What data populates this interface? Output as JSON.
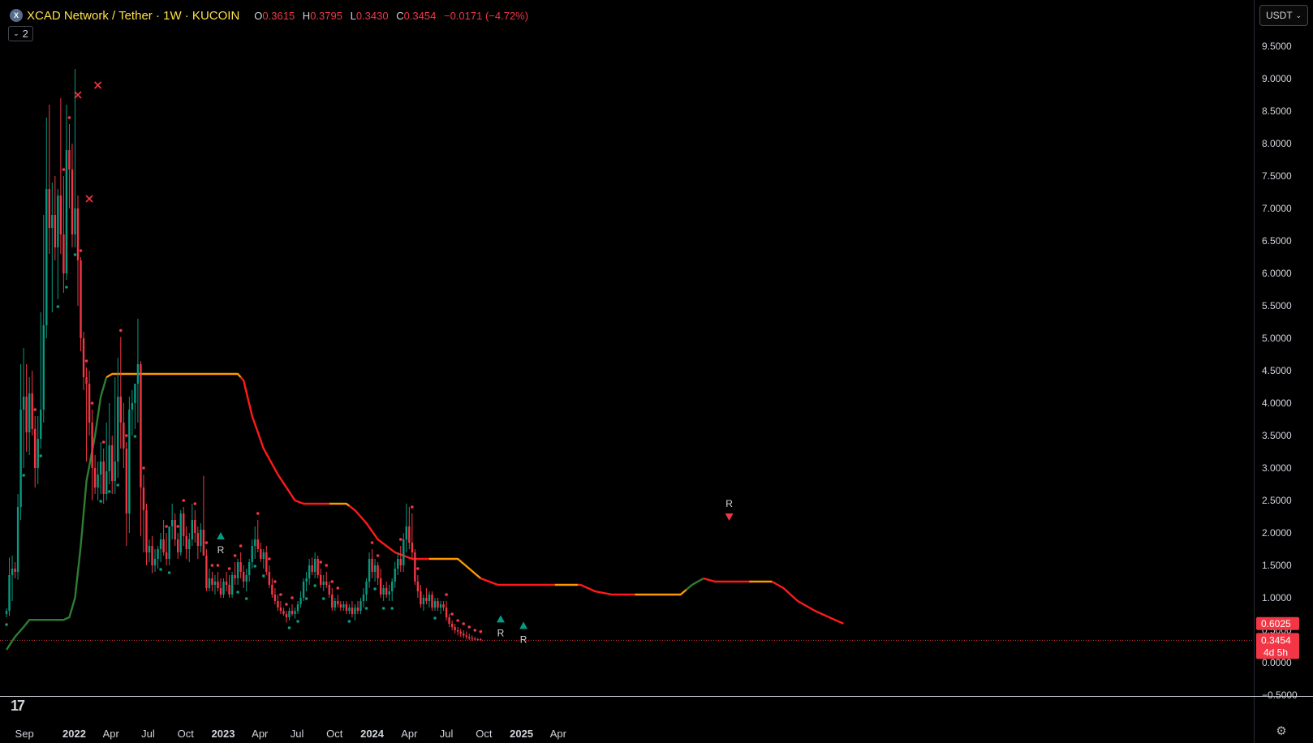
{
  "header": {
    "title": "XCAD Network / Tether · 1W · KUCOIN",
    "o_label": "O",
    "o_value": "0.3615",
    "h_label": "H",
    "h_value": "0.3795",
    "l_label": "L",
    "l_value": "0.3430",
    "c_label": "C",
    "c_value": "0.3454",
    "change": "−0.0171 (−4.72%)"
  },
  "legend_toggle": {
    "count": "2",
    "icon": "chevron-down-icon"
  },
  "currency_button": {
    "label": "USDT",
    "icon": "chevron-down-icon"
  },
  "price_labels": {
    "indicator": {
      "value": "0.6025",
      "color": "#f23645"
    },
    "last": {
      "value": "0.3454",
      "countdown": "4d 5h",
      "color": "#f23645"
    }
  },
  "colors": {
    "up": "#089981",
    "down": "#f23645",
    "trend_up": "#2e7d32",
    "trend_down": "#ff1a1a",
    "flat": "#ff9800",
    "text": "#d1d4dc",
    "background": "#000000"
  },
  "chart_data": {
    "type": "candlestick",
    "symbol": "XCAD Network / Tether",
    "interval": "1W",
    "exchange": "KUCOIN",
    "ylim": [
      -0.5,
      10
    ],
    "y_ticks": [
      "9.5000",
      "9.0000",
      "8.5000",
      "8.0000",
      "7.5000",
      "7.0000",
      "6.5000",
      "6.0000",
      "5.5000",
      "5.0000",
      "4.5000",
      "4.0000",
      "3.5000",
      "3.0000",
      "2.5000",
      "2.0000",
      "1.5000",
      "1.0000",
      "0.5000",
      "0.0000",
      "−0.5000"
    ],
    "x_ticks": [
      {
        "label": "Sep",
        "date": "2021-09-01",
        "bold": false
      },
      {
        "label": "2022",
        "date": "2022-01-01",
        "bold": true
      },
      {
        "label": "Apr",
        "date": "2022-04-01",
        "bold": false
      },
      {
        "label": "Jul",
        "date": "2022-07-01",
        "bold": false
      },
      {
        "label": "Oct",
        "date": "2022-10-01",
        "bold": false
      },
      {
        "label": "2023",
        "date": "2023-01-01",
        "bold": true
      },
      {
        "label": "Apr",
        "date": "2023-04-01",
        "bold": false
      },
      {
        "label": "Jul",
        "date": "2023-07-01",
        "bold": false
      },
      {
        "label": "Oct",
        "date": "2023-10-01",
        "bold": false
      },
      {
        "label": "2024",
        "date": "2024-01-01",
        "bold": true
      },
      {
        "label": "Apr",
        "date": "2024-04-01",
        "bold": false
      },
      {
        "label": "Jul",
        "date": "2024-07-01",
        "bold": false
      },
      {
        "label": "Oct",
        "date": "2024-10-01",
        "bold": false
      },
      {
        "label": "2025",
        "date": "2025-01-01",
        "bold": true
      },
      {
        "label": "Apr",
        "date": "2025-04-01",
        "bold": false
      }
    ],
    "first_bar_date": "2021-07-19",
    "candles": [
      [
        0.75,
        0.84,
        0.7,
        0.8
      ],
      [
        0.8,
        1.62,
        0.72,
        1.35
      ],
      [
        1.35,
        1.65,
        0.95,
        1.45
      ],
      [
        1.45,
        1.55,
        1.3,
        1.4
      ],
      [
        1.4,
        2.6,
        1.28,
        2.4
      ],
      [
        2.4,
        4.6,
        2.2,
        3.9
      ],
      [
        3.9,
        4.85,
        3.0,
        4.1
      ],
      [
        4.1,
        4.6,
        3.25,
        3.55
      ],
      [
        3.55,
        4.4,
        3.2,
        4.15
      ],
      [
        4.15,
        4.5,
        3.5,
        3.6
      ],
      [
        3.6,
        3.8,
        2.7,
        3.0
      ],
      [
        3.0,
        3.8,
        2.75,
        3.45
      ],
      [
        3.45,
        5.4,
        3.3,
        3.9
      ],
      [
        3.9,
        6.9,
        3.7,
        5.2
      ],
      [
        5.2,
        8.4,
        5.0,
        7.3
      ],
      [
        7.3,
        8.6,
        6.3,
        6.7
      ],
      [
        6.7,
        7.4,
        5.4,
        6.9
      ],
      [
        6.9,
        7.5,
        6.2,
        6.4
      ],
      [
        6.4,
        7.3,
        5.6,
        7.2
      ],
      [
        7.2,
        8.7,
        6.3,
        6.6
      ],
      [
        6.6,
        7.5,
        5.7,
        6.0
      ],
      [
        6.0,
        8.6,
        5.9,
        7.9
      ],
      [
        7.9,
        8.3,
        7.0,
        7.6
      ],
      [
        7.6,
        8.0,
        6.4,
        6.6
      ],
      [
        6.6,
        9.15,
        6.4,
        7.0
      ],
      [
        7.0,
        7.2,
        5.5,
        6.2
      ],
      [
        6.2,
        6.25,
        4.8,
        5.0
      ],
      [
        5.0,
        5.1,
        4.2,
        4.4
      ],
      [
        4.4,
        4.55,
        3.1,
        4.3
      ],
      [
        4.3,
        4.5,
        3.5,
        3.7
      ],
      [
        3.7,
        3.9,
        2.5,
        3.0
      ],
      [
        3.0,
        3.2,
        2.6,
        2.7
      ],
      [
        2.7,
        3.1,
        2.5,
        2.9
      ],
      [
        2.9,
        3.4,
        2.6,
        3.1
      ],
      [
        3.1,
        3.3,
        2.45,
        2.6
      ],
      [
        2.6,
        3.7,
        2.5,
        2.95
      ],
      [
        2.95,
        4.0,
        2.75,
        3.35
      ],
      [
        3.35,
        3.5,
        2.6,
        2.8
      ],
      [
        2.8,
        4.4,
        2.6,
        3.1
      ],
      [
        3.1,
        4.7,
        2.85,
        4.1
      ],
      [
        4.1,
        5.02,
        3.3,
        3.7
      ],
      [
        3.7,
        4.0,
        3.0,
        3.3
      ],
      [
        3.3,
        3.4,
        1.8,
        2.3
      ],
      [
        2.3,
        4.1,
        2.0,
        3.9
      ],
      [
        3.9,
        4.2,
        3.5,
        4.0
      ],
      [
        4.0,
        4.3,
        3.6,
        4.3
      ],
      [
        4.3,
        5.3,
        3.7,
        4.6
      ],
      [
        4.6,
        4.65,
        1.95,
        2.7
      ],
      [
        2.7,
        2.9,
        1.7,
        2.35
      ],
      [
        2.35,
        2.45,
        1.5,
        1.7
      ],
      [
        1.7,
        1.9,
        1.55,
        1.8
      ],
      [
        1.8,
        1.95,
        1.38,
        1.5
      ],
      [
        1.5,
        1.75,
        1.4,
        1.6
      ],
      [
        1.6,
        1.8,
        1.45,
        1.75
      ],
      [
        1.75,
        2.0,
        1.55,
        1.9
      ],
      [
        1.9,
        2.2,
        1.65,
        1.7
      ],
      [
        1.7,
        2.0,
        1.5,
        1.6
      ],
      [
        1.6,
        2.05,
        1.5,
        2.1
      ],
      [
        2.1,
        2.45,
        1.9,
        2.2
      ],
      [
        2.2,
        2.3,
        1.8,
        1.9
      ],
      [
        1.9,
        2.0,
        1.6,
        1.7
      ],
      [
        1.7,
        2.35,
        1.65,
        2.3
      ],
      [
        2.3,
        2.4,
        1.8,
        1.95
      ],
      [
        1.95,
        2.1,
        1.6,
        1.75
      ],
      [
        1.75,
        2.0,
        1.55,
        1.9
      ],
      [
        1.9,
        2.45,
        1.8,
        2.2
      ],
      [
        2.2,
        2.35,
        1.85,
        2.0
      ],
      [
        2.0,
        2.1,
        1.6,
        1.8
      ],
      [
        1.8,
        2.15,
        1.7,
        2.05
      ],
      [
        2.05,
        2.88,
        1.75,
        1.65
      ],
      [
        1.65,
        1.75,
        1.1,
        1.15
      ],
      [
        1.15,
        1.45,
        1.1,
        1.3
      ],
      [
        1.3,
        1.4,
        1.1,
        1.2
      ],
      [
        1.2,
        1.35,
        1.05,
        1.25
      ],
      [
        1.25,
        1.4,
        1.1,
        1.15
      ],
      [
        1.15,
        1.3,
        1.0,
        1.05
      ],
      [
        1.05,
        1.3,
        1.0,
        1.25
      ],
      [
        1.25,
        1.4,
        1.1,
        1.2
      ],
      [
        1.2,
        1.35,
        1.0,
        1.05
      ],
      [
        1.05,
        1.4,
        1.0,
        1.35
      ],
      [
        1.35,
        1.55,
        1.2,
        1.3
      ],
      [
        1.3,
        1.6,
        1.2,
        1.55
      ],
      [
        1.55,
        1.7,
        1.3,
        1.4
      ],
      [
        1.4,
        1.5,
        1.15,
        1.25
      ],
      [
        1.25,
        1.45,
        1.1,
        1.35
      ],
      [
        1.35,
        1.6,
        1.25,
        1.55
      ],
      [
        1.55,
        1.9,
        1.45,
        1.8
      ],
      [
        1.8,
        2.1,
        1.6,
        1.9
      ],
      [
        1.9,
        2.2,
        1.7,
        1.75
      ],
      [
        1.75,
        1.85,
        1.55,
        1.6
      ],
      [
        1.6,
        1.75,
        1.45,
        1.7
      ],
      [
        1.7,
        1.8,
        1.35,
        1.4
      ],
      [
        1.4,
        1.5,
        1.15,
        1.2
      ],
      [
        1.2,
        1.3,
        1.0,
        1.05
      ],
      [
        1.05,
        1.15,
        0.9,
        0.95
      ],
      [
        0.95,
        1.05,
        0.8,
        0.85
      ],
      [
        0.85,
        0.95,
        0.75,
        0.8
      ],
      [
        0.8,
        0.85,
        0.72,
        0.75
      ],
      [
        0.75,
        0.8,
        0.62,
        0.7
      ],
      [
        0.7,
        0.85,
        0.65,
        0.8
      ],
      [
        0.8,
        0.9,
        0.72,
        0.75
      ],
      [
        0.75,
        0.85,
        0.68,
        0.8
      ],
      [
        0.8,
        0.95,
        0.75,
        0.9
      ],
      [
        0.9,
        1.1,
        0.85,
        1.0
      ],
      [
        1.0,
        1.3,
        0.95,
        1.25
      ],
      [
        1.25,
        1.4,
        1.1,
        1.3
      ],
      [
        1.3,
        1.6,
        1.2,
        1.5
      ],
      [
        1.5,
        1.62,
        1.35,
        1.4
      ],
      [
        1.4,
        1.7,
        1.3,
        1.6
      ],
      [
        1.6,
        1.65,
        1.3,
        1.35
      ],
      [
        1.35,
        1.45,
        1.15,
        1.2
      ],
      [
        1.2,
        1.35,
        1.1,
        1.25
      ],
      [
        1.25,
        1.4,
        1.15,
        1.2
      ],
      [
        1.2,
        1.25,
        1.0,
        1.05
      ],
      [
        1.05,
        1.15,
        0.8,
        0.85
      ],
      [
        0.85,
        1.0,
        0.8,
        0.95
      ],
      [
        0.95,
        1.05,
        0.85,
        0.9
      ],
      [
        0.9,
        0.95,
        0.8,
        0.85
      ],
      [
        0.85,
        0.95,
        0.8,
        0.9
      ],
      [
        0.9,
        0.95,
        0.75,
        0.8
      ],
      [
        0.8,
        0.9,
        0.75,
        0.85
      ],
      [
        0.85,
        0.95,
        0.7,
        0.75
      ],
      [
        0.75,
        0.9,
        0.65,
        0.85
      ],
      [
        0.85,
        0.95,
        0.75,
        0.8
      ],
      [
        0.8,
        1.0,
        0.75,
        0.95
      ],
      [
        0.95,
        1.15,
        0.85,
        1.05
      ],
      [
        1.05,
        1.3,
        0.95,
        1.25
      ],
      [
        1.25,
        1.7,
        1.15,
        1.6
      ],
      [
        1.6,
        1.75,
        1.3,
        1.4
      ],
      [
        1.4,
        1.6,
        1.25,
        1.5
      ],
      [
        1.5,
        1.55,
        1.2,
        1.3
      ],
      [
        1.3,
        1.45,
        1.0,
        1.05
      ],
      [
        1.05,
        1.2,
        0.95,
        1.15
      ],
      [
        1.15,
        1.25,
        1.0,
        1.05
      ],
      [
        1.05,
        1.2,
        0.95,
        1.1
      ],
      [
        1.1,
        1.3,
        0.95,
        1.25
      ],
      [
        1.25,
        1.55,
        1.15,
        1.45
      ],
      [
        1.45,
        1.7,
        1.35,
        1.6
      ],
      [
        1.6,
        1.8,
        1.4,
        1.5
      ],
      [
        1.5,
        2.0,
        1.4,
        1.9
      ],
      [
        1.9,
        2.45,
        1.7,
        2.1
      ],
      [
        2.1,
        2.4,
        1.75,
        1.85
      ],
      [
        1.85,
        2.3,
        1.6,
        1.7
      ],
      [
        1.7,
        1.75,
        1.2,
        1.25
      ],
      [
        1.25,
        1.35,
        1.0,
        1.1
      ],
      [
        1.1,
        1.2,
        0.85,
        0.9
      ],
      [
        0.9,
        1.05,
        0.8,
        1.0
      ],
      [
        1.0,
        1.15,
        0.9,
        0.95
      ],
      [
        0.95,
        1.1,
        0.85,
        1.05
      ],
      [
        1.05,
        1.1,
        0.8,
        0.85
      ],
      [
        0.85,
        1.0,
        0.8,
        0.95
      ],
      [
        0.95,
        1.0,
        0.8,
        0.85
      ],
      [
        0.85,
        0.95,
        0.75,
        0.9
      ],
      [
        0.9,
        0.95,
        0.8,
        0.85
      ],
      [
        0.85,
        0.95,
        0.65,
        0.7
      ],
      [
        0.7,
        0.75,
        0.55,
        0.6
      ],
      [
        0.6,
        0.65,
        0.5,
        0.55
      ],
      [
        0.55,
        0.6,
        0.45,
        0.5
      ],
      [
        0.5,
        0.55,
        0.42,
        0.48
      ],
      [
        0.48,
        0.52,
        0.4,
        0.45
      ],
      [
        0.45,
        0.5,
        0.38,
        0.42
      ],
      [
        0.42,
        0.48,
        0.36,
        0.4
      ],
      [
        0.4,
        0.45,
        0.35,
        0.38
      ],
      [
        0.38,
        0.42,
        0.34,
        0.37
      ],
      [
        0.37,
        0.4,
        0.34,
        0.36
      ],
      [
        0.36,
        0.38,
        0.34,
        0.35
      ],
      [
        0.3615,
        0.3795,
        0.343,
        0.3454
      ]
    ],
    "trend_line": [
      [
        0,
        0.2
      ],
      [
        3,
        0.4
      ],
      [
        6,
        0.55
      ],
      [
        8,
        0.66
      ],
      [
        20,
        0.66
      ],
      [
        22,
        0.7
      ],
      [
        24,
        1.0
      ],
      [
        26,
        1.8
      ],
      [
        28,
        2.8
      ],
      [
        31,
        3.5
      ],
      [
        33,
        4.1
      ],
      [
        35,
        4.4
      ],
      [
        37,
        4.45
      ],
      [
        81,
        4.45
      ],
      [
        83,
        4.35
      ],
      [
        86,
        3.8
      ],
      [
        90,
        3.3
      ],
      [
        95,
        2.9
      ],
      [
        101,
        2.5
      ],
      [
        104,
        2.45
      ],
      [
        119,
        2.45
      ],
      [
        122,
        2.35
      ],
      [
        126,
        2.15
      ],
      [
        130,
        1.9
      ],
      [
        136,
        1.7
      ],
      [
        142,
        1.6
      ],
      [
        158,
        1.6
      ],
      [
        162,
        1.45
      ],
      [
        166,
        1.3
      ],
      [
        172,
        1.2
      ],
      [
        178,
        1.2
      ],
      [
        201,
        1.2
      ],
      [
        206,
        1.1
      ],
      [
        212,
        1.05
      ],
      [
        236,
        1.05
      ],
      [
        240,
        1.2
      ],
      [
        244,
        1.3
      ],
      [
        248,
        1.25
      ],
      [
        268,
        1.25
      ],
      [
        272,
        1.15
      ],
      [
        277,
        0.95
      ],
      [
        283,
        0.8
      ],
      [
        288,
        0.7
      ],
      [
        293,
        0.6025
      ]
    ],
    "trend_segments": [
      {
        "from": 0,
        "to": 35,
        "state": "up"
      },
      {
        "from": 35,
        "to": 82,
        "state": "flat"
      },
      {
        "from": 82,
        "to": 113,
        "state": "down"
      },
      {
        "from": 113,
        "to": 120,
        "state": "flat"
      },
      {
        "from": 120,
        "to": 148,
        "state": "down"
      },
      {
        "from": 148,
        "to": 166,
        "state": "flat"
      },
      {
        "from": 166,
        "to": 192,
        "state": "down"
      },
      {
        "from": 192,
        "to": 200,
        "state": "flat"
      },
      {
        "from": 200,
        "to": 220,
        "state": "down"
      },
      {
        "from": 220,
        "to": 238,
        "state": "flat"
      },
      {
        "from": 238,
        "to": 244,
        "state": "up"
      },
      {
        "from": 244,
        "to": 260,
        "state": "down"
      },
      {
        "from": 260,
        "to": 268,
        "state": "flat"
      },
      {
        "from": 268,
        "to": 293,
        "state": "down"
      }
    ],
    "markers": [
      {
        "bar": 25,
        "price": 8.75,
        "shape": "x",
        "color": "#f23645",
        "label": ""
      },
      {
        "bar": 29,
        "price": 7.15,
        "shape": "x",
        "color": "#f23645",
        "label": ""
      },
      {
        "bar": 32,
        "price": 8.9,
        "shape": "x",
        "color": "#f23645",
        "label": ""
      },
      {
        "bar": 75,
        "price": 1.95,
        "shape": "triangle-up",
        "color": "#089981",
        "label": "R"
      },
      {
        "bar": 173,
        "price": 0.67,
        "shape": "triangle-up",
        "color": "#089981",
        "label": "R"
      },
      {
        "bar": 181,
        "price": 0.57,
        "shape": "triangle-up",
        "color": "#089981",
        "label": "R"
      },
      {
        "bar": 253,
        "price": 2.25,
        "shape": "triangle-down",
        "color": "#f23645",
        "label": "R"
      }
    ]
  }
}
